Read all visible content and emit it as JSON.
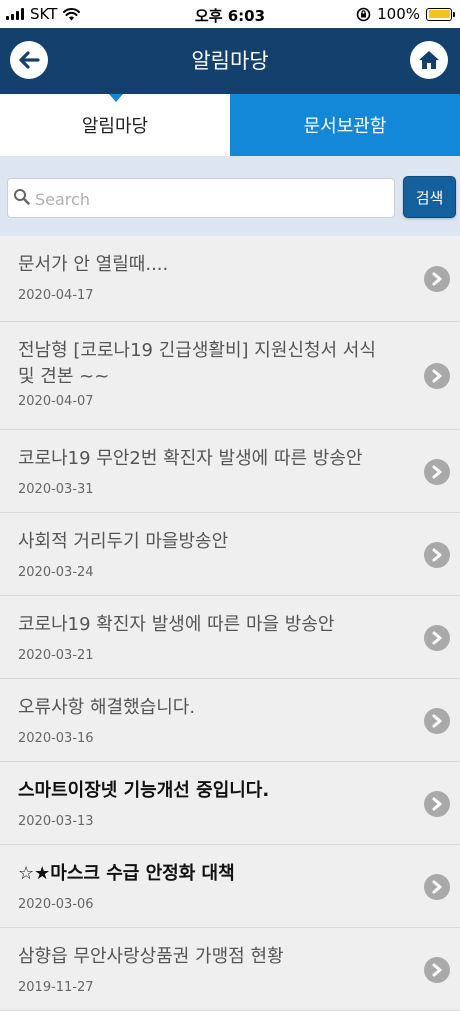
{
  "status_bar": {
    "carrier": "SKT",
    "time": "오후 6:03",
    "battery_percent": "100%",
    "battery_level": 1.0
  },
  "header": {
    "title": "알림마당"
  },
  "tabs": [
    {
      "label": "알림마당",
      "active": true
    },
    {
      "label": "문서보관함",
      "active": false
    }
  ],
  "search": {
    "placeholder": "Search",
    "value": "",
    "button_label": "검색"
  },
  "notices": [
    {
      "title": "문서가 안 열릴때....",
      "date": "2020-04-17",
      "bold": false
    },
    {
      "title": "전남형 [코로나19 긴급생활비] 지원신청서 서식 및 견본 ~~",
      "date": "2020-04-07",
      "bold": false
    },
    {
      "title": "코로나19 무안2번 확진자 발생에 따른 방송안",
      "date": "2020-03-31",
      "bold": false
    },
    {
      "title": "사회적 거리두기 마을방송안",
      "date": "2020-03-24",
      "bold": false
    },
    {
      "title": "코로나19 확진자 발생에 따른 마을 방송안",
      "date": "2020-03-21",
      "bold": false
    },
    {
      "title": "오류사항 해결했습니다.",
      "date": "2020-03-16",
      "bold": false
    },
    {
      "title": "스마트이장넷 기능개선 중입니다.",
      "date": "2020-03-13",
      "bold": true
    },
    {
      "title": "☆★마스크 수급 안정화 대책",
      "date": "2020-03-06",
      "bold": true
    },
    {
      "title": "삼향읍 무안사랑상품권 가맹점 현황",
      "date": "2019-11-27",
      "bold": false
    }
  ],
  "colors": {
    "header_bg": "#14406d",
    "tab_inactive_bg": "#1488d8",
    "search_button_bg": "#14609c",
    "battery_fill": "#f2c318"
  }
}
